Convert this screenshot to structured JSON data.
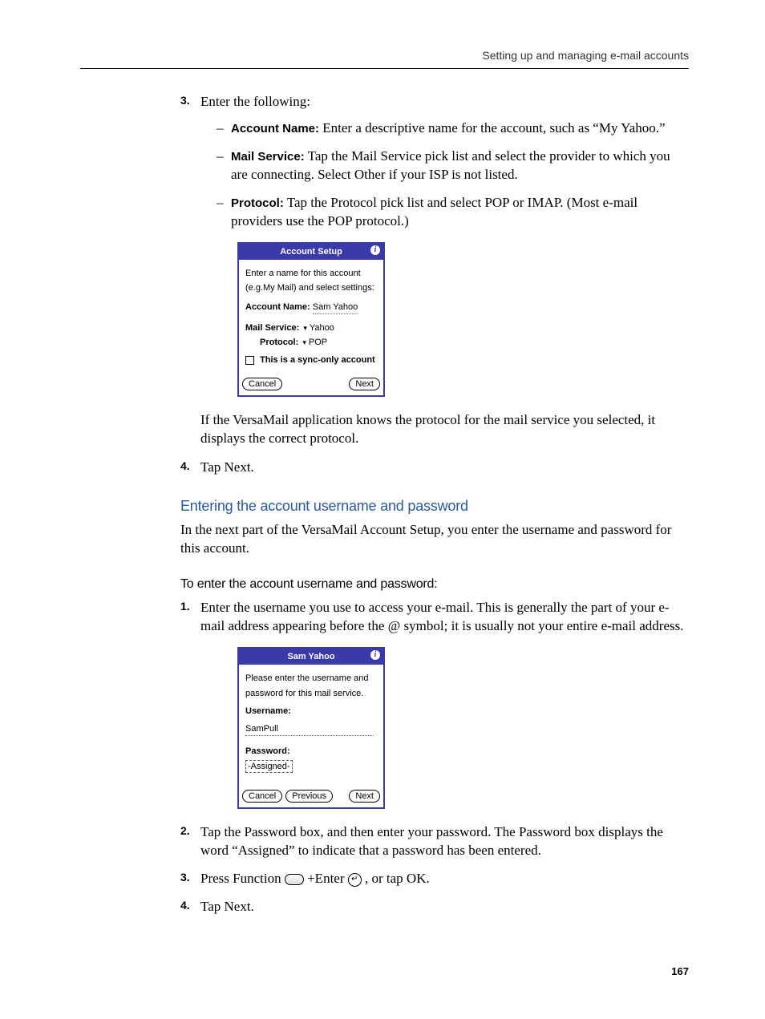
{
  "header": "Setting up and managing e-mail accounts",
  "step3": {
    "num": "3.",
    "intro": "Enter the following:",
    "items": [
      {
        "label": "Account Name:",
        "text": " Enter a descriptive name for the account, such as “My Yahoo.”"
      },
      {
        "label": "Mail Service:",
        "text": " Tap the Mail Service pick list and select the provider to which you are connecting. Select Other if your ISP is not listed."
      },
      {
        "label": "Protocol:",
        "text": " Tap the Protocol pick list and select POP or IMAP. (Most e-mail providers use the POP protocol.)"
      }
    ]
  },
  "palm1": {
    "title": "Account Setup",
    "instruction1": "Enter a name for this account",
    "instruction2": "(e.g.My Mail) and select settings:",
    "acct_label": "Account Name:",
    "acct_value": "Sam Yahoo",
    "mail_label": "Mail Service:",
    "mail_value": "Yahoo",
    "proto_label": "Protocol:",
    "proto_value": "POP",
    "sync_label": "This is a sync-only account",
    "cancel": "Cancel",
    "next": "Next"
  },
  "after_palm1": "If the VersaMail application knows the protocol for the mail service you selected, it displays the correct protocol.",
  "step4a": {
    "num": "4.",
    "text": "Tap Next."
  },
  "h3": "Entering the account username and password",
  "h3_para": "In the next part of the VersaMail Account Setup, you enter the username and password for this account.",
  "h4": "To enter the account username and password:",
  "step1b": {
    "num": "1.",
    "text": "Enter the username you use to access your e-mail. This is generally the part of your e-mail address appearing before the @ symbol; it is usually not your entire e-mail address."
  },
  "palm2": {
    "title": "Sam Yahoo",
    "instruction1": "Please enter the username and",
    "instruction2": "password for this mail service.",
    "user_label": "Username:",
    "user_value": "SamPull",
    "pass_label": "Password:",
    "pass_value": "-Assigned-",
    "cancel": "Cancel",
    "previous": "Previous",
    "next": "Next"
  },
  "step2b": {
    "num": "2.",
    "text": "Tap the Password box, and then enter your password. The Password box displays the word “Assigned” to indicate that a password has been entered."
  },
  "step3b": {
    "num": "3.",
    "pre": "Press Function ",
    "mid": " +Enter ",
    "post": " , or tap OK."
  },
  "step4b": {
    "num": "4.",
    "text": "Tap Next."
  },
  "page": "167"
}
